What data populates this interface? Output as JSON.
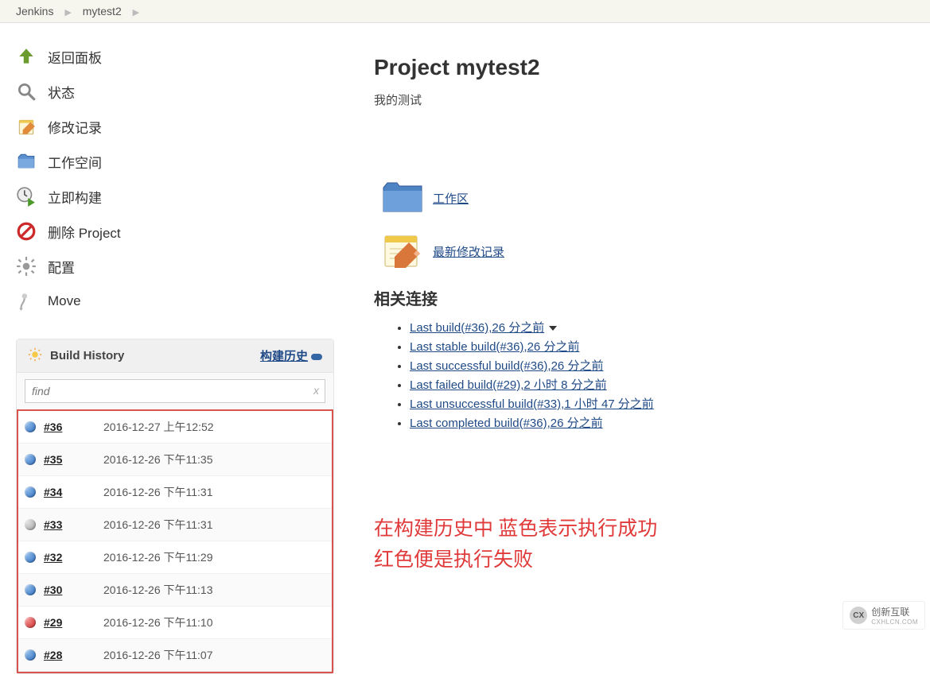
{
  "breadcrumbs": {
    "root": "Jenkins",
    "project": "mytest2"
  },
  "sidebar": {
    "items": [
      {
        "label": "返回面板"
      },
      {
        "label": "状态"
      },
      {
        "label": "修改记录"
      },
      {
        "label": "工作空间"
      },
      {
        "label": "立即构建"
      },
      {
        "label": "删除 Project"
      },
      {
        "label": "配置"
      },
      {
        "label": "Move"
      }
    ]
  },
  "buildHistory": {
    "title": "Build History",
    "linkLabel": "构建历史",
    "searchPlaceholder": "find",
    "clearLabel": "x",
    "rows": [
      {
        "num": "#36",
        "time": "2016-12-27 上午12:52",
        "status": "blue"
      },
      {
        "num": "#35",
        "time": "2016-12-26 下午11:35",
        "status": "blue"
      },
      {
        "num": "#34",
        "time": "2016-12-26 下午11:31",
        "status": "blue"
      },
      {
        "num": "#33",
        "time": "2016-12-26 下午11:31",
        "status": "grey"
      },
      {
        "num": "#32",
        "time": "2016-12-26 下午11:29",
        "status": "blue"
      },
      {
        "num": "#30",
        "time": "2016-12-26 下午11:13",
        "status": "blue"
      },
      {
        "num": "#29",
        "time": "2016-12-26 下午11:10",
        "status": "red"
      },
      {
        "num": "#28",
        "time": "2016-12-26 下午11:07",
        "status": "blue"
      }
    ]
  },
  "main": {
    "title": "Project mytest2",
    "description": "我的测试",
    "workspaceLink": "工作区",
    "changesLink": "最新修改记录",
    "relatedHeading": "相关连接",
    "links": [
      {
        "text": "Last build(#36),26 分之前",
        "caret": true
      },
      {
        "text": "Last stable build(#36),26 分之前"
      },
      {
        "text": "Last successful build(#36),26 分之前"
      },
      {
        "text": "Last failed build(#29),2 小时 8 分之前"
      },
      {
        "text": "Last unsuccessful build(#33),1 小时 47 分之前"
      },
      {
        "text": "Last completed build(#36),26 分之前"
      }
    ],
    "annotationLine1": "在构建历史中 蓝色表示执行成功",
    "annotationLine2": "红色便是执行失败"
  },
  "watermark": {
    "text": "创新互联",
    "sub": "CXHLCN.COM"
  }
}
